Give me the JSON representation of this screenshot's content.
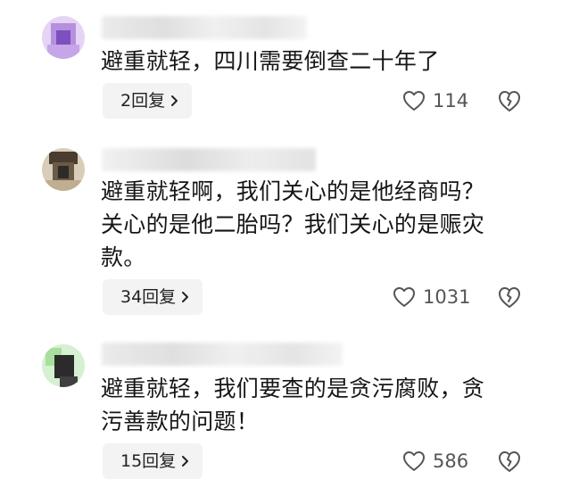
{
  "comments": [
    {
      "text": "避重就轻，四川需要倒查二十年了",
      "replies_label": "2回复",
      "likes": "114",
      "avatar_colors": [
        "#c9a9e6",
        "#8f63c9",
        "#e7d4f4"
      ]
    },
    {
      "text": "避重就轻啊，我们关心的是他经商吗？\n关心的是他二胎吗？我们关心的是赈灾\n款。",
      "replies_label": "34回复",
      "likes": "1031",
      "avatar_colors": [
        "#c7b59a",
        "#5a4a3a",
        "#e2d6c3"
      ]
    },
    {
      "text": "避重就轻，我们要查的是贪污腐败，贪\n污善款的问题！",
      "replies_label": "15回复",
      "likes": "586",
      "avatar_colors": [
        "#a9dba4",
        "#2c2c2c",
        "#cfeecb"
      ]
    }
  ],
  "icons": {
    "like": "heart-outline-icon",
    "dislike": "broken-heart-icon",
    "reply_chevron": "chevron-right-icon"
  }
}
